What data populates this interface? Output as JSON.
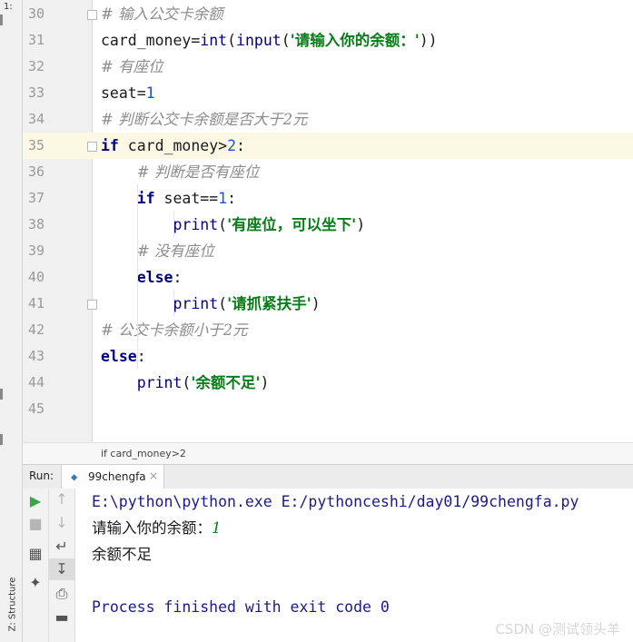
{
  "left_strip": {
    "project_label": "1:",
    "structure_label": "Z: Structure"
  },
  "editor": {
    "lines": [
      {
        "num": "30",
        "parts": [
          [
            "cm",
            "# 输入公交卡余额"
          ]
        ]
      },
      {
        "num": "31",
        "parts": [
          [
            "plain",
            "card_money="
          ],
          [
            "bi",
            "int"
          ],
          [
            "plain",
            "("
          ],
          [
            "bi",
            "input"
          ],
          [
            "plain",
            "("
          ],
          [
            "str",
            "'请输入你的余额：'"
          ],
          [
            "plain",
            "))"
          ]
        ]
      },
      {
        "num": "32",
        "parts": [
          [
            "cm",
            "# 有座位"
          ]
        ]
      },
      {
        "num": "33",
        "parts": [
          [
            "plain",
            "seat="
          ],
          [
            "num",
            "1"
          ]
        ]
      },
      {
        "num": "34",
        "parts": [
          [
            "cm",
            "# 判断公交卡余额是否大于2元"
          ]
        ]
      },
      {
        "num": "35",
        "parts": [
          [
            "kw",
            "if"
          ],
          [
            "plain",
            " card_money>"
          ],
          [
            "num",
            "2"
          ],
          [
            "plain",
            ":"
          ]
        ]
      },
      {
        "num": "36",
        "parts": [
          [
            "plain",
            "    "
          ],
          [
            "cm",
            "# 判断是否有座位"
          ]
        ]
      },
      {
        "num": "37",
        "parts": [
          [
            "plain",
            "    "
          ],
          [
            "kw",
            "if"
          ],
          [
            "plain",
            " seat=="
          ],
          [
            "num",
            "1"
          ],
          [
            "plain",
            ":"
          ]
        ]
      },
      {
        "num": "38",
        "parts": [
          [
            "plain",
            "        "
          ],
          [
            "bi",
            "print"
          ],
          [
            "plain",
            "("
          ],
          [
            "str",
            "'有座位，可以坐下'"
          ],
          [
            "plain",
            ")"
          ]
        ]
      },
      {
        "num": "39",
        "parts": [
          [
            "plain",
            "    "
          ],
          [
            "cm",
            "# 没有座位"
          ]
        ]
      },
      {
        "num": "40",
        "parts": [
          [
            "plain",
            "    "
          ],
          [
            "kw",
            "else"
          ],
          [
            "plain",
            ":"
          ]
        ]
      },
      {
        "num": "41",
        "parts": [
          [
            "plain",
            "        "
          ],
          [
            "bi",
            "print"
          ],
          [
            "plain",
            "("
          ],
          [
            "str",
            "'请抓紧扶手'"
          ],
          [
            "plain",
            ")"
          ]
        ]
      },
      {
        "num": "42",
        "parts": [
          [
            "cm",
            "# 公交卡余额小于2元"
          ]
        ]
      },
      {
        "num": "43",
        "parts": [
          [
            "kw",
            "else"
          ],
          [
            "plain",
            ":"
          ]
        ]
      },
      {
        "num": "44",
        "parts": [
          [
            "plain",
            "    "
          ],
          [
            "bi",
            "print"
          ],
          [
            "plain",
            "("
          ],
          [
            "str",
            "'余额不足'"
          ],
          [
            "plain",
            ")"
          ]
        ]
      },
      {
        "num": "45",
        "parts": []
      }
    ],
    "current_line": "35"
  },
  "breadcrumb": "if card_money>2",
  "run_panel": {
    "label": "Run:",
    "tab_name": "99chengfa",
    "tab_icon": "python-icon",
    "close_symbol": "×",
    "console": {
      "command": "E:\\python\\python.exe E:/pythonceshi/day01/99chengfa.py",
      "prompt": "请输入你的余额：",
      "input_value": "1",
      "output": "余额不足",
      "exit_message": "Process finished with exit code 0"
    }
  },
  "watermark": "CSDN @测试领头羊",
  "colors": {
    "keyword": "#000080",
    "comment": "#8c8c8c",
    "string": "#067d17",
    "number": "#1750eb",
    "current_line": "#fdf8e4"
  }
}
